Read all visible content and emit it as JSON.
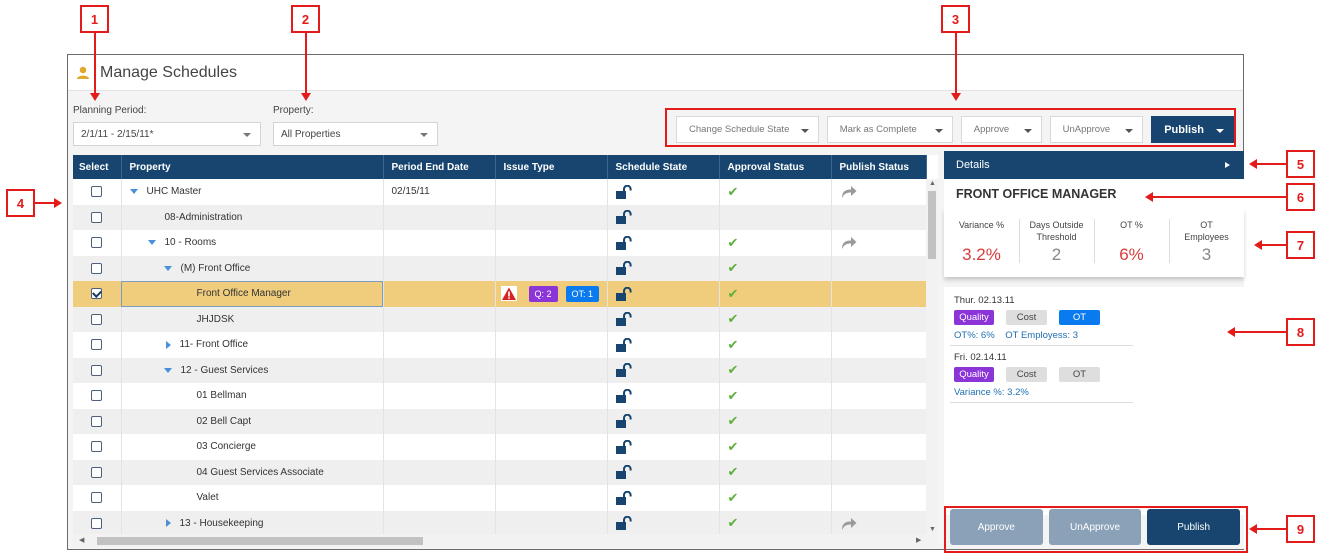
{
  "window": {
    "title": "Manage Schedules",
    "title_icon": "user-icon",
    "icon_color": "#e0a82e"
  },
  "filters": {
    "planning_period": {
      "label": "Planning Period:",
      "value": "2/1/11 - 2/15/11*"
    },
    "property": {
      "label": "Property:",
      "value": "All Properties"
    }
  },
  "actions": {
    "change_schedule_state": "Change Schedule State",
    "mark_as_complete": "Mark as Complete",
    "approve": "Approve",
    "unapprove": "UnApprove",
    "publish": "Publish"
  },
  "grid": {
    "columns": [
      "Select",
      "Property",
      "Period End Date",
      "Issue Type",
      "Schedule State",
      "Approval Status",
      "Publish Status"
    ],
    "rows": [
      {
        "checked": false,
        "level": 0,
        "toggle": "expanded",
        "name": "UHC Master",
        "period_end": "02/15/11",
        "issues": null,
        "schedule_state": "unlocked",
        "approved": true,
        "published": true
      },
      {
        "checked": false,
        "level": 1,
        "toggle": null,
        "name": "08-Administration",
        "period_end": "",
        "issues": null,
        "schedule_state": "unlocked",
        "approved": false,
        "published": false
      },
      {
        "checked": false,
        "level": 1,
        "toggle": "expanded",
        "name": "10 - Rooms",
        "period_end": "",
        "issues": null,
        "schedule_state": "unlocked",
        "approved": true,
        "published": true
      },
      {
        "checked": false,
        "level": 2,
        "toggle": "expanded",
        "name": "(M) Front Office",
        "period_end": "",
        "issues": null,
        "schedule_state": "unlocked",
        "approved": true,
        "published": false
      },
      {
        "checked": true,
        "level": 3,
        "toggle": null,
        "name": "Front Office Manager",
        "period_end": "",
        "issues": {
          "warning": true,
          "quality": "Q: 2",
          "ot": "OT: 1"
        },
        "schedule_state": "unlocked",
        "approved": true,
        "published": false,
        "selected": true
      },
      {
        "checked": false,
        "level": 3,
        "toggle": null,
        "name": "JHJDSK",
        "period_end": "",
        "issues": null,
        "schedule_state": "unlocked",
        "approved": true,
        "published": false
      },
      {
        "checked": false,
        "level": 2,
        "toggle": "collapsed",
        "name": "11- Front Office",
        "period_end": "",
        "issues": null,
        "schedule_state": "unlocked",
        "approved": true,
        "published": false
      },
      {
        "checked": false,
        "level": 2,
        "toggle": "expanded",
        "name": "12 - Guest Services",
        "period_end": "",
        "issues": null,
        "schedule_state": "unlocked",
        "approved": true,
        "published": false
      },
      {
        "checked": false,
        "level": 3,
        "toggle": null,
        "name": "01 Bellman",
        "period_end": "",
        "issues": null,
        "schedule_state": "unlocked",
        "approved": true,
        "published": false
      },
      {
        "checked": false,
        "level": 3,
        "toggle": null,
        "name": "02 Bell Capt",
        "period_end": "",
        "issues": null,
        "schedule_state": "unlocked",
        "approved": true,
        "published": false
      },
      {
        "checked": false,
        "level": 3,
        "toggle": null,
        "name": "03 Concierge",
        "period_end": "",
        "issues": null,
        "schedule_state": "unlocked",
        "approved": true,
        "published": false
      },
      {
        "checked": false,
        "level": 3,
        "toggle": null,
        "name": "04 Guest Services Associate",
        "period_end": "",
        "issues": null,
        "schedule_state": "unlocked",
        "approved": true,
        "published": false
      },
      {
        "checked": false,
        "level": 3,
        "toggle": null,
        "name": "Valet",
        "period_end": "",
        "issues": null,
        "schedule_state": "unlocked",
        "approved": true,
        "published": false
      },
      {
        "checked": false,
        "level": 2,
        "toggle": "collapsed",
        "name": "13 - Housekeeping",
        "period_end": "",
        "issues": null,
        "schedule_state": "unlocked",
        "approved": true,
        "published": true
      }
    ]
  },
  "details": {
    "header": "Details",
    "role": "FRONT OFFICE MANAGER",
    "stats": [
      {
        "label": "Variance %",
        "value": "3.2%",
        "alert": true
      },
      {
        "label": "Days Outside Threshold",
        "value": "2",
        "alert": false
      },
      {
        "label": "OT %",
        "value": "6%",
        "alert": true
      },
      {
        "label": "OT Employees",
        "value": "3",
        "alert": false
      }
    ],
    "days": [
      {
        "date": "Thur. 02.13.11",
        "chips": {
          "quality": "Quality",
          "cost": "Cost",
          "ot": "OT"
        },
        "ot_active": true,
        "metrics": [
          "OT%: 6%",
          "OT Employess: 3"
        ]
      },
      {
        "date": "Fri. 02.14.11",
        "chips": {
          "quality": "Quality",
          "cost": "Cost",
          "ot": "OT"
        },
        "ot_active": false,
        "metrics": [
          "Variance %: 3.2%"
        ]
      }
    ],
    "footer": {
      "approve": "Approve",
      "unapprove": "UnApprove",
      "publish": "Publish"
    }
  },
  "annotations": [
    "1",
    "2",
    "3",
    "4",
    "5",
    "6",
    "7",
    "8",
    "9"
  ],
  "colors": {
    "primary": "#17456f",
    "selected_row": "#efcd7d",
    "alert": "#d93b3b",
    "quality": "#8b35d9",
    "ot": "#0a7bef",
    "approved": "#5cb03a",
    "annotation": "#e31b1b"
  }
}
